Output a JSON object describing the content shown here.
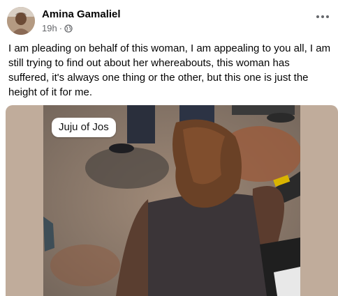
{
  "post": {
    "author": "Amina Gamaliel",
    "time": "19h",
    "audience_icon": "globe-icon",
    "menu_icon": "more-horizontal-icon",
    "text": "I am pleading on behalf of this woman, I am appealing to you all, I am still trying to find out about her whereabouts, this woman has suffered, it's always one thing or the other, but this one is just the height of it for me."
  },
  "media": {
    "caption": "Juju of Jos"
  },
  "colors": {
    "primary_text": "#050505",
    "secondary_text": "#65676b",
    "media_background": "#c0ac9b"
  }
}
